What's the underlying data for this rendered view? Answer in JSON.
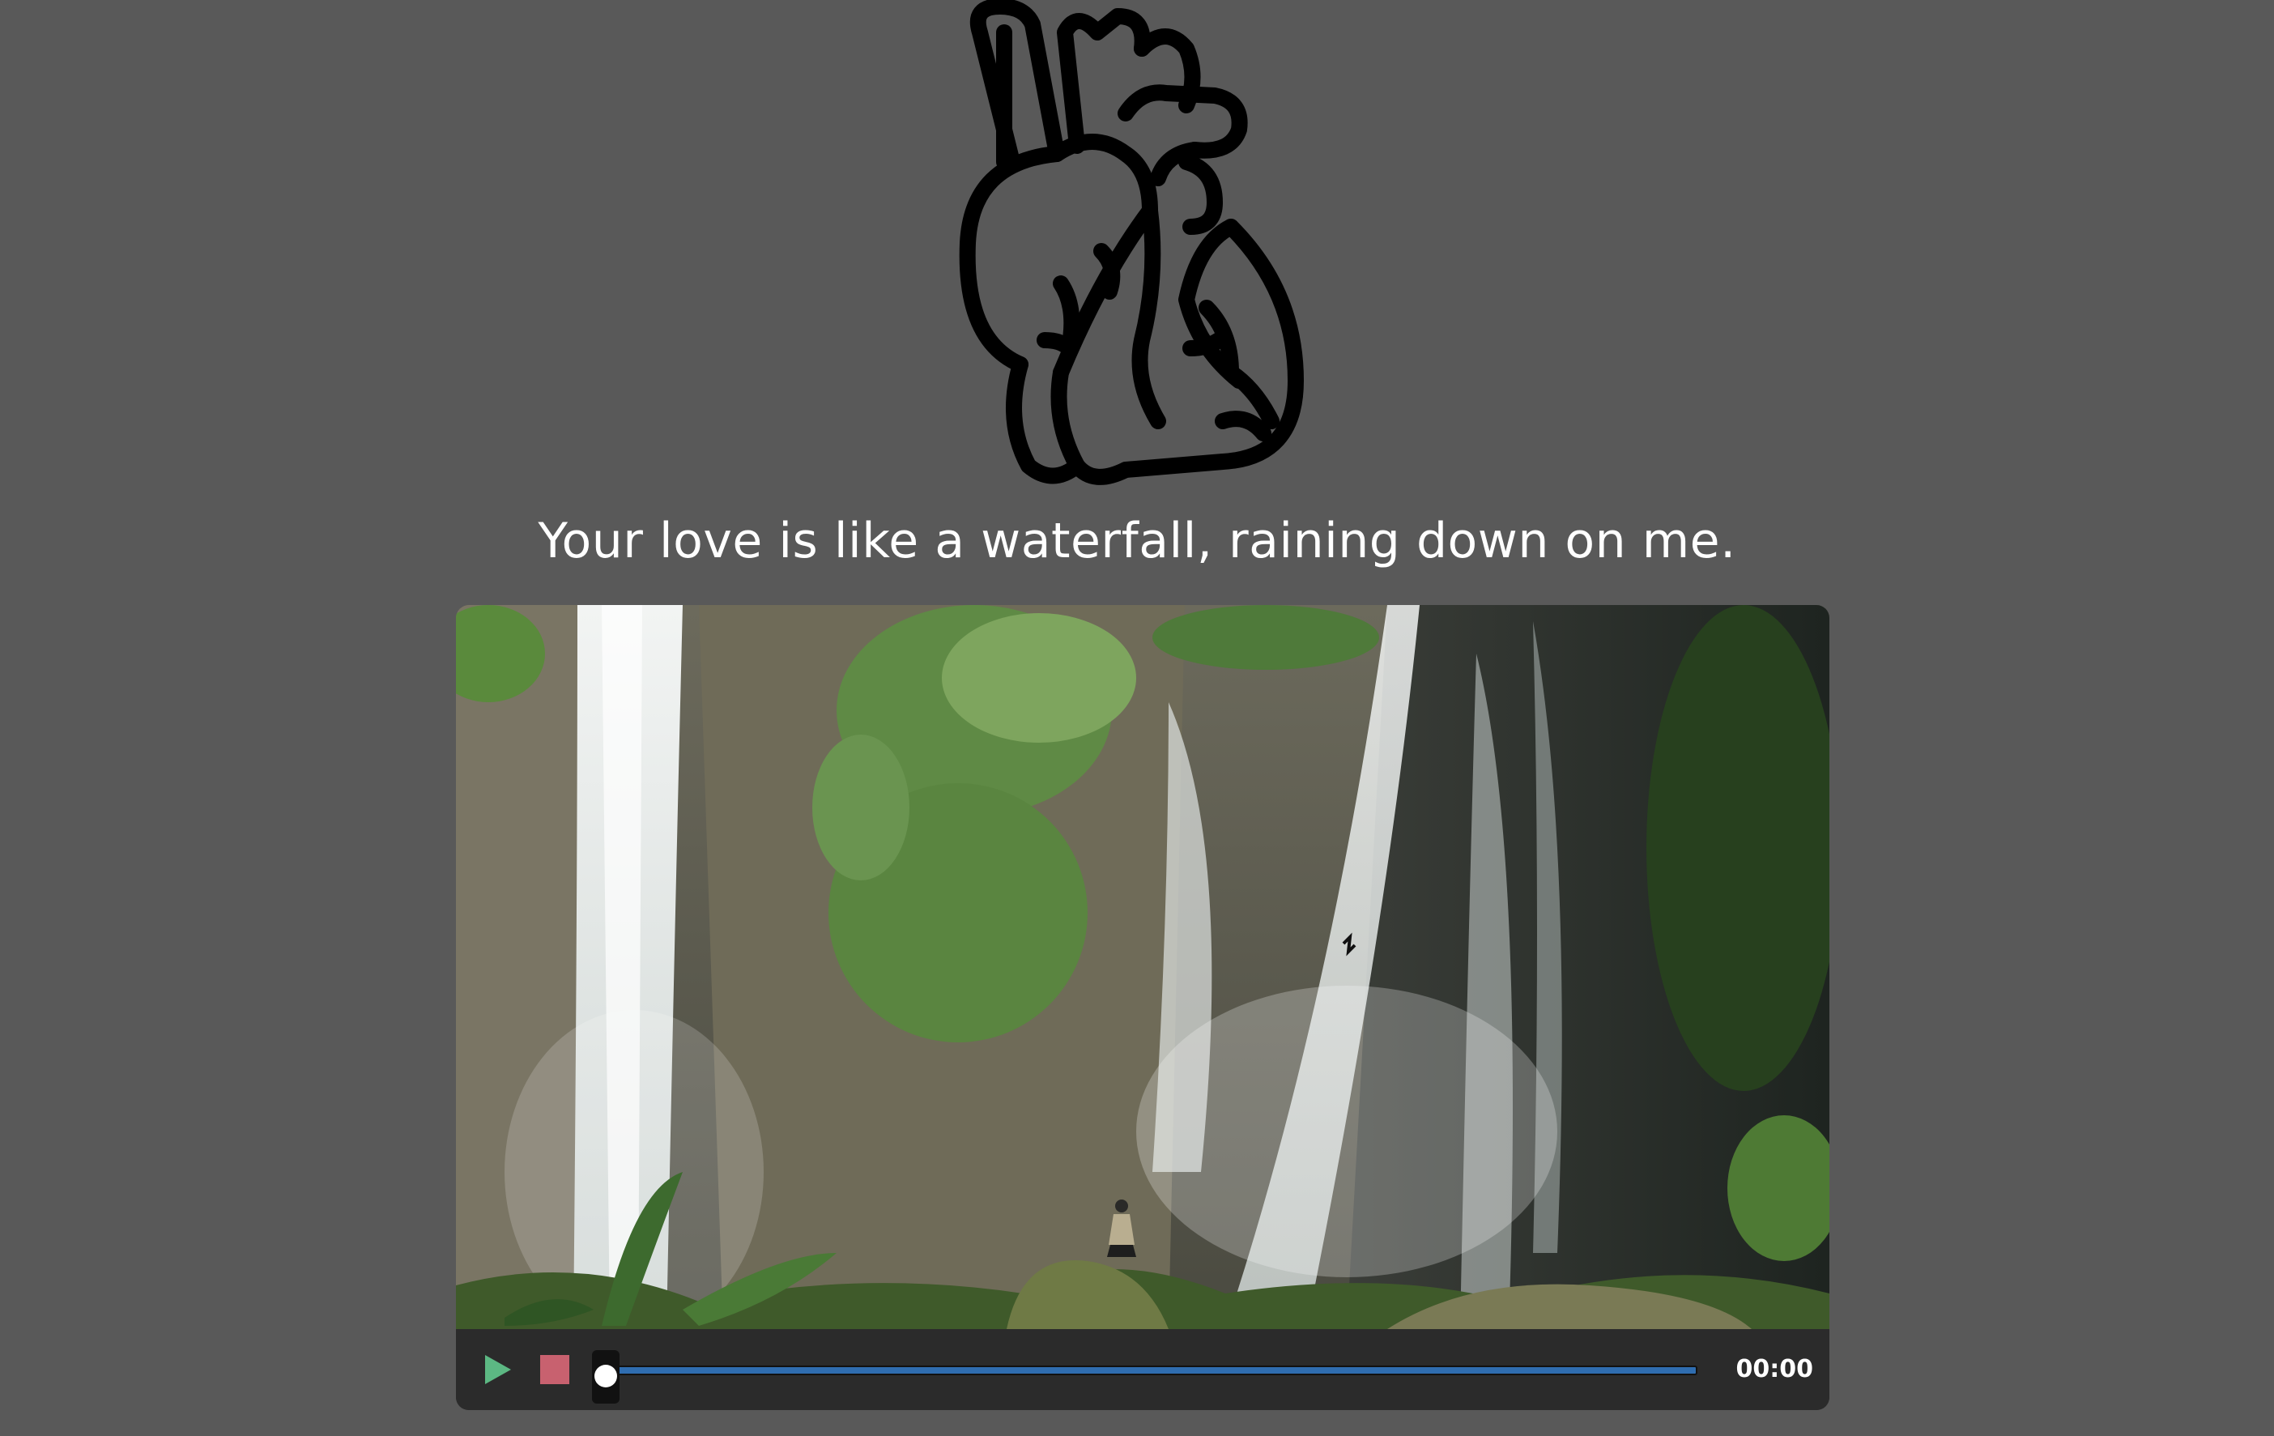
{
  "header": {
    "icon": "anatomical-heart-icon",
    "tagline": "Your love is like a waterfall, raining down on me."
  },
  "video_player": {
    "scene": "waterfall-video-frame",
    "play_icon": "play-icon",
    "stop_icon": "stop-icon",
    "progress": 0,
    "time": "00:00",
    "colors": {
      "background": "#595959",
      "play": "#5cb883",
      "stop": "#c8616f",
      "progress": "#2f6db0",
      "controls_bar": "#2b2b2b"
    }
  }
}
